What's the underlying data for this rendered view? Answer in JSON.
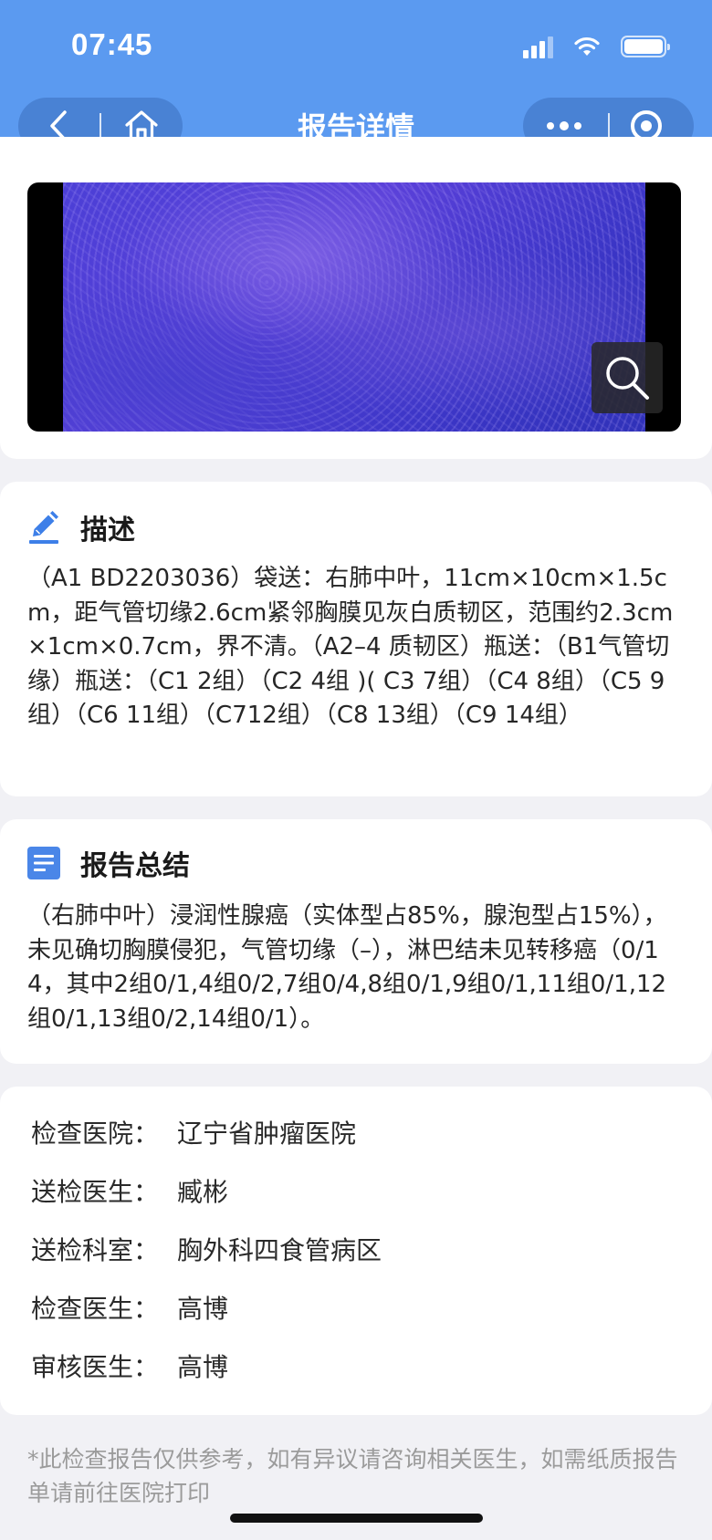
{
  "status_bar": {
    "time": "07:45",
    "icons": [
      "signal-icon",
      "wifi-icon",
      "battery-icon"
    ]
  },
  "nav": {
    "title": "报告详情",
    "left_buttons": [
      "back-icon",
      "home-icon"
    ],
    "right_buttons": [
      "more-icon",
      "record-icon"
    ]
  },
  "image_card": {
    "zoom_icon": "search-icon"
  },
  "description": {
    "icon": "pencil-icon",
    "title": "描述",
    "body": "（A1 BD2203036）袋送：右肺中叶，11cm×10cm×1.5cm，距气管切缘2.6cm紧邻胸膜见灰白质韧区，范围约2.3cm×1cm×0.7cm，界不清。（A2–4 质韧区）瓶送：（B1气管切缘）瓶送：（C1 2组）（C2 4组 )( C3 7组）（C4 8组）（C5 9组）（C6 11组）（C712组）（C8 13组）（C9 14组）"
  },
  "summary": {
    "icon": "document-list-icon",
    "title": "报告总结",
    "body": "（右肺中叶）浸润性腺癌（实体型占85%，腺泡型占15%），未见确切胸膜侵犯，气管切缘（–），淋巴结未见转移癌（0/14，其中2组0/1,4组0/2,7组0/4,8组0/1,9组0/1,11组0/1,12组0/1,13组0/2,14组0/1）。"
  },
  "info": {
    "rows": [
      {
        "label": "检查医院：",
        "value": "辽宁省肿瘤医院"
      },
      {
        "label": "送检医生：",
        "value": "臧彬"
      },
      {
        "label": "送检科室：",
        "value": "胸外科四食管病区"
      },
      {
        "label": "检查医生：",
        "value": "高博"
      },
      {
        "label": "审核医生：",
        "value": "高博"
      }
    ]
  },
  "disclaimer": "*此检查报告仅供参考，如有异议请咨询相关医生，如需纸质报告单请前往医院打印",
  "colors": {
    "header": "#5b9af0",
    "accent": "#4a86e8",
    "background": "#f1f1f5"
  }
}
